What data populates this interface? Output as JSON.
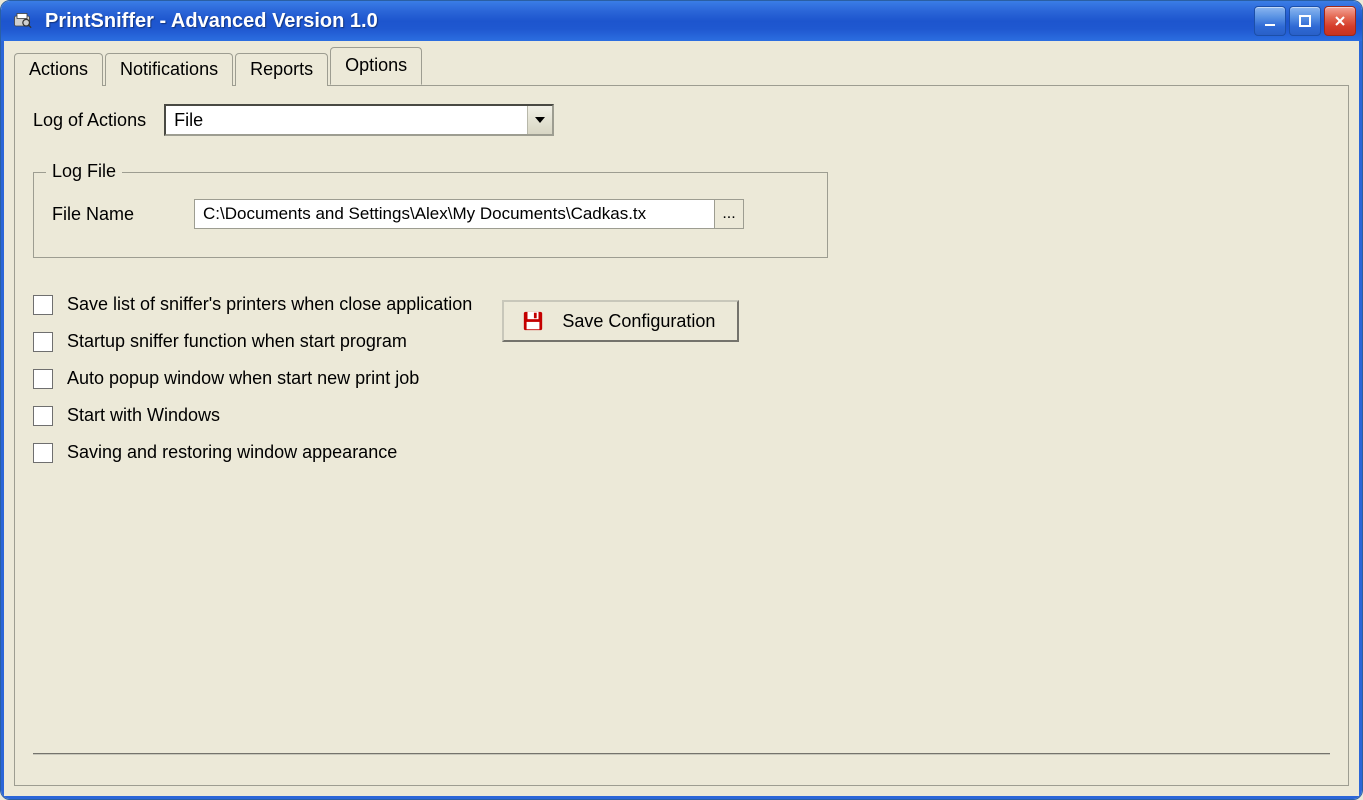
{
  "window": {
    "title": "PrintSniffer - Advanced Version 1.0"
  },
  "tabs": [
    {
      "label": "Actions",
      "active": false
    },
    {
      "label": "Notifications",
      "active": false
    },
    {
      "label": "Reports",
      "active": false
    },
    {
      "label": "Options",
      "active": true
    }
  ],
  "options": {
    "log_of_actions_label": "Log of Actions",
    "log_of_actions_value": "File",
    "logfile_group_legend": "Log File",
    "file_name_label": "File Name",
    "file_name_value": "C:\\Documents and Settings\\Alex\\My Documents\\Cadkas.tx",
    "browse_label": "...",
    "checkboxes": [
      {
        "label": "Save list of sniffer's printers when close application",
        "checked": false
      },
      {
        "label": "Startup sniffer function when start program",
        "checked": false
      },
      {
        "label": "Auto popup window when start new print job",
        "checked": false
      },
      {
        "label": "Start with Windows",
        "checked": false
      },
      {
        "label": "Saving and restoring window appearance",
        "checked": false
      }
    ],
    "save_config_label": "Save Configuration"
  }
}
